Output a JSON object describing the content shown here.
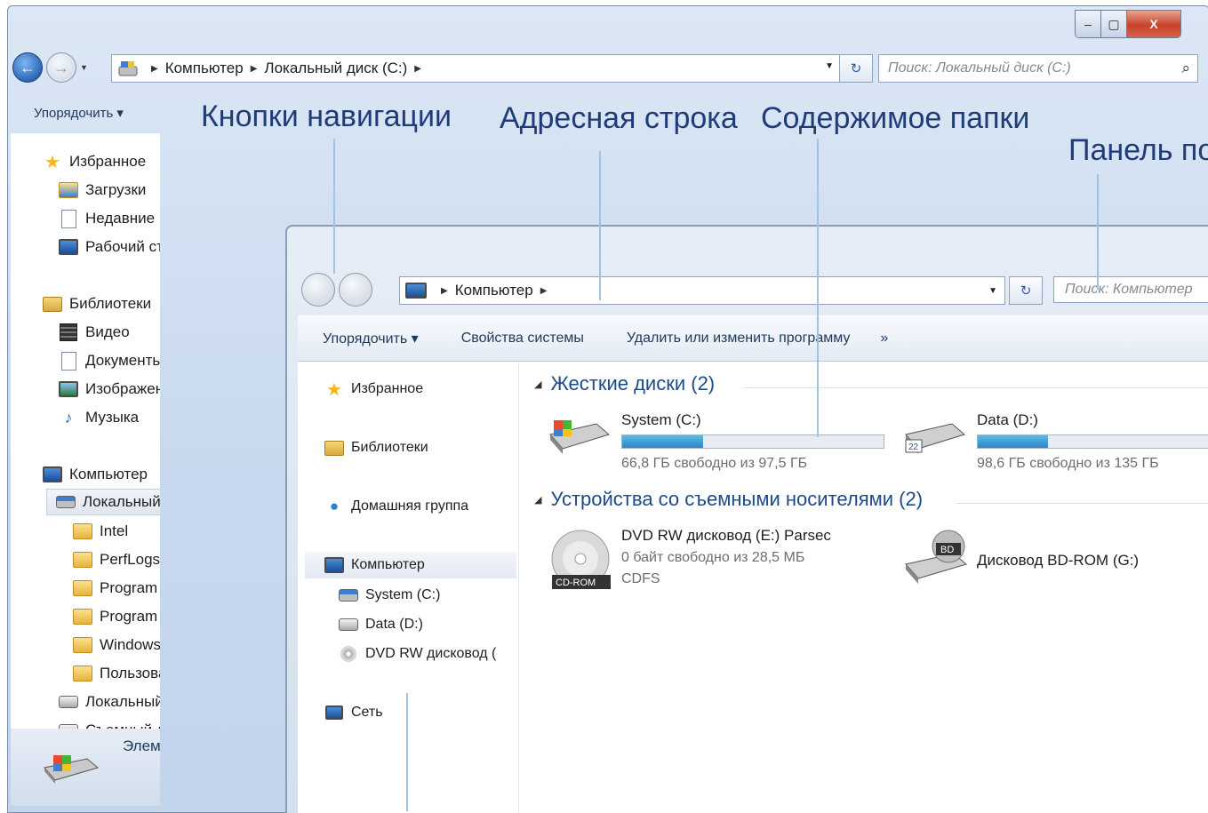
{
  "outer_window": {
    "controls": {
      "minimize": "‒",
      "maximize": "▢",
      "close": "X"
    },
    "address": {
      "crumbs": [
        "Компьютер",
        "Локальный диск (C:)"
      ]
    },
    "search": {
      "placeholder": "Поиск: Локальный диск (C:)"
    },
    "toolbar": {
      "organize": "Упорядочить ▾"
    },
    "navpane": {
      "favorites": "Избранное",
      "downloads": "Загрузки",
      "recent": "Недавние м",
      "desktop": "Рабочий ст",
      "libraries": "Библиотеки",
      "video": "Видео",
      "documents": "Документь",
      "images": "Изображен",
      "music": "Музыка",
      "computer": "Компьютер",
      "local_c": "Локальный",
      "intel": "Intel",
      "perflogs": "PerfLogs",
      "program1": "Program",
      "program2": "Program",
      "windows": "Windows",
      "users": "Пользова",
      "local_other": "Локальный",
      "removable": "Съемный д"
    },
    "status": {
      "text": "Элем"
    }
  },
  "labels": {
    "nav_buttons": "Кнопки навигации",
    "address_bar": "Адресная строка",
    "folder_contents": "Содержимое папки",
    "panel": "Панель по"
  },
  "inner_window": {
    "address": {
      "crumbs": [
        "Компьютер"
      ]
    },
    "search": {
      "placeholder": "Поиск: Компьютер"
    },
    "toolbar": {
      "organize": "Упорядочить ▾",
      "system_props": "Свойства системы",
      "uninstall": "Удалить или изменить программу",
      "more": "»"
    },
    "navpane": {
      "favorites": "Избранное",
      "libraries": "Библиотеки",
      "homegroup": "Домашняя группа",
      "computer": "Компьютер",
      "system_c": "System (C:)",
      "data_d": "Data (D:)",
      "dvd": "DVD RW дисковод (",
      "network": "Сеть"
    },
    "hard_drives": {
      "heading": "Жесткие диски (2)",
      "items": [
        {
          "name": "System (C:)",
          "free": "66,8 ГБ свободно из 97,5 ГБ",
          "used_fraction": 0.31
        },
        {
          "name": "Data (D:)",
          "free": "98,6 ГБ свободно из 135 ГБ",
          "used_fraction": 0.27
        }
      ]
    },
    "removable": {
      "heading": "Устройства со съемными носителями (2)",
      "dvd": {
        "name": "DVD RW дисковод (E:) Parsec",
        "free": "0 байт свободно из 28,5 МБ",
        "fs": "CDFS",
        "badge": "CD-ROM"
      },
      "bd": {
        "name": "Дисковод BD-ROM (G:)",
        "badge": "BD"
      }
    },
    "icons": {
      "d_badge": "22"
    }
  },
  "colors": {
    "label_blue": "#1f3c78",
    "callout": "#9ec3e6",
    "bar_fill": "#2b86c5"
  }
}
